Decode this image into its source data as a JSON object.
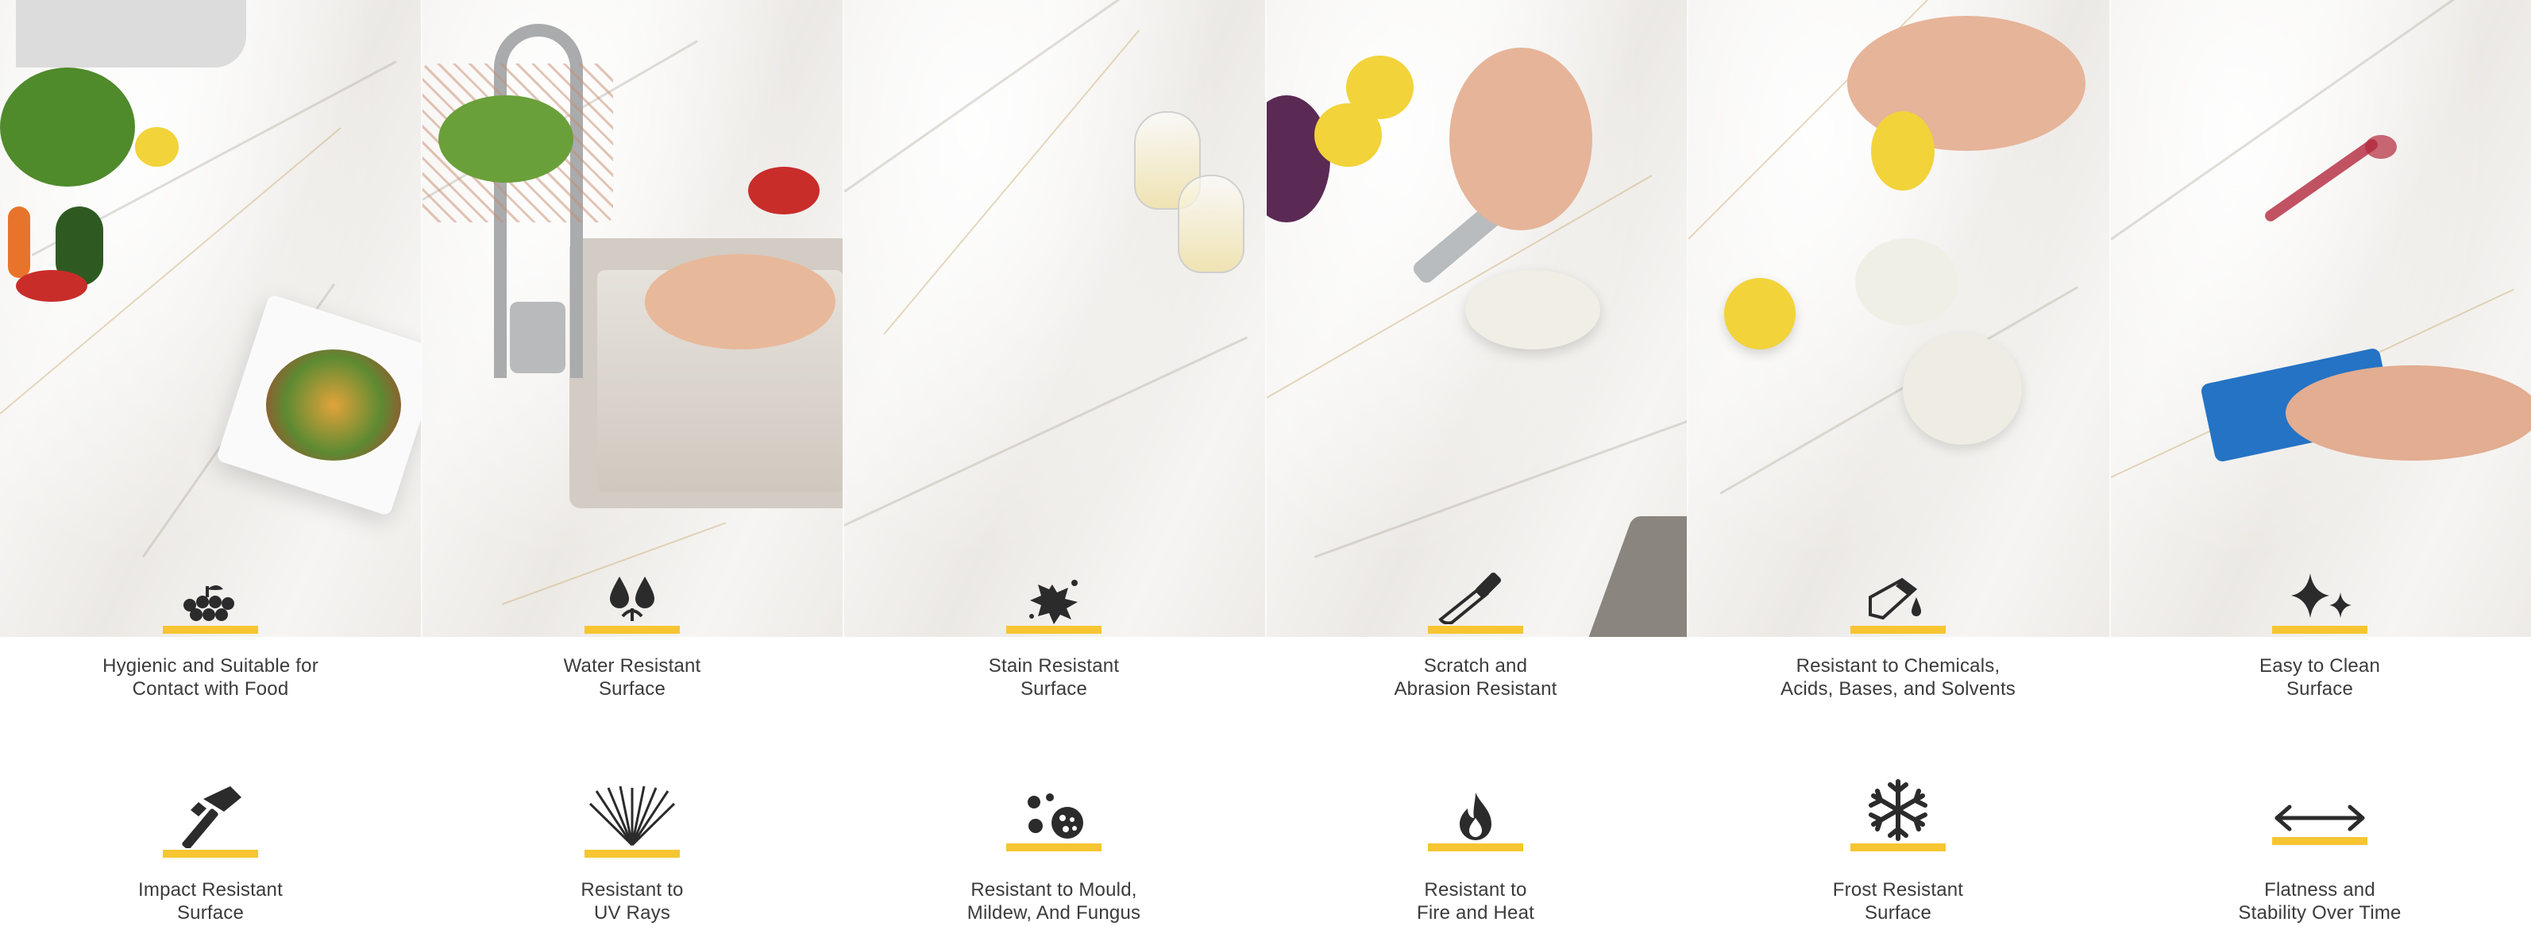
{
  "colors": {
    "accent_bar": "#f6c531",
    "icon": "#2b2b2b",
    "text": "#3b3b3b"
  },
  "panels": [
    {
      "photo": "vegetables-and-salad-on-marble-counter"
    },
    {
      "photo": "hands-washing-tomatoes-under-faucet"
    },
    {
      "photo": "two-wine-glasses-on-marble"
    },
    {
      "photo": "knife-cutting-fennel"
    },
    {
      "photo": "lemon-squeezed-on-fennel"
    },
    {
      "photo": "hand-wiping-wine-stain-with-sponge"
    }
  ],
  "features_top": [
    {
      "icon": "grapes-icon",
      "line1": "Hygienic and Suitable for",
      "line2": "Contact with Food"
    },
    {
      "icon": "water-drops-icon",
      "line1": "Water Resistant",
      "line2": "Surface"
    },
    {
      "icon": "splash-stain-icon",
      "line1": "Stain Resistant",
      "line2": "Surface"
    },
    {
      "icon": "knife-icon",
      "line1": "Scratch and",
      "line2": "Abrasion Resistant"
    },
    {
      "icon": "chemical-pour-icon",
      "line1": "Resistant to Chemicals,",
      "line2": "Acids, Bases, and Solvents"
    },
    {
      "icon": "sparkle-icon",
      "line1": "Easy to Clean",
      "line2": "Surface"
    }
  ],
  "features_bottom": [
    {
      "icon": "hammer-icon",
      "line1": "Impact Resistant",
      "line2": "Surface"
    },
    {
      "icon": "uv-rays-icon",
      "line1": "Resistant to",
      "line2": "UV Rays"
    },
    {
      "icon": "mould-spores-icon",
      "line1": "Resistant to Mould,",
      "line2": "Mildew, And Fungus"
    },
    {
      "icon": "flame-icon",
      "line1": "Resistant to",
      "line2": "Fire and Heat"
    },
    {
      "icon": "snowflake-icon",
      "line1": "Frost Resistant",
      "line2": "Surface"
    },
    {
      "icon": "double-arrow-icon",
      "line1": "Flatness and",
      "line2": "Stability Over Time"
    }
  ]
}
